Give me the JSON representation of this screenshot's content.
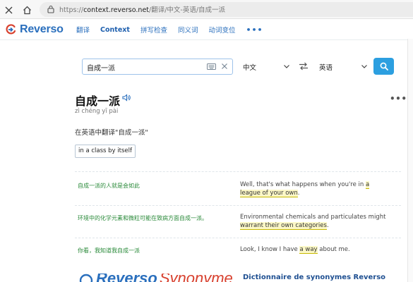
{
  "browser": {
    "url_scheme": "https://",
    "url_host": "context.reverso.net",
    "url_path": "/翻译/中文-英语/自成一派"
  },
  "nav": {
    "logo_text": "Reverso",
    "links": [
      "翻译",
      "Context",
      "拼写检查",
      "同义词",
      "动词变位"
    ],
    "more": "•••",
    "brand_color": "#2a6fbd"
  },
  "search": {
    "query": "自成一派",
    "source_lang": "中文",
    "target_lang": "英语"
  },
  "entry": {
    "headword": "自成一派",
    "pinyin": "zì chéng yī pài",
    "translate_label": "在英语中翻译\"自成一派\"",
    "translation_chip": "in a class by itself",
    "more": "•••"
  },
  "examples": [
    {
      "source_pre": "",
      "source_hl": "自成一派",
      "source_post": "的人就是会如此",
      "target_pre": "Well, that's what happens when you're in ",
      "target_hl": "a league of your own",
      "target_post": "."
    },
    {
      "source_pre": "环境中的化学元素和微粒可能在致病方面",
      "source_hl": "自成一派",
      "source_post": "。",
      "target_pre": "Environmental chemicals and particulates might ",
      "target_hl": "warrant their own categories",
      "target_post": "."
    },
    {
      "source_pre": "你看，我知道我",
      "source_hl": "自成一派",
      "source_post": "",
      "target_pre": "Look, I know I have ",
      "target_hl": "a way",
      "target_post": " about me."
    }
  ],
  "banner": {
    "logo_part1": "Reverso",
    "logo_part2": "Synonyme",
    "title": "Dictionnaire de synonymes Reverso"
  },
  "colors": {
    "accent": "#2c9fe0",
    "source_text": "#2a8a3a",
    "highlight": "#fbf7c6"
  }
}
